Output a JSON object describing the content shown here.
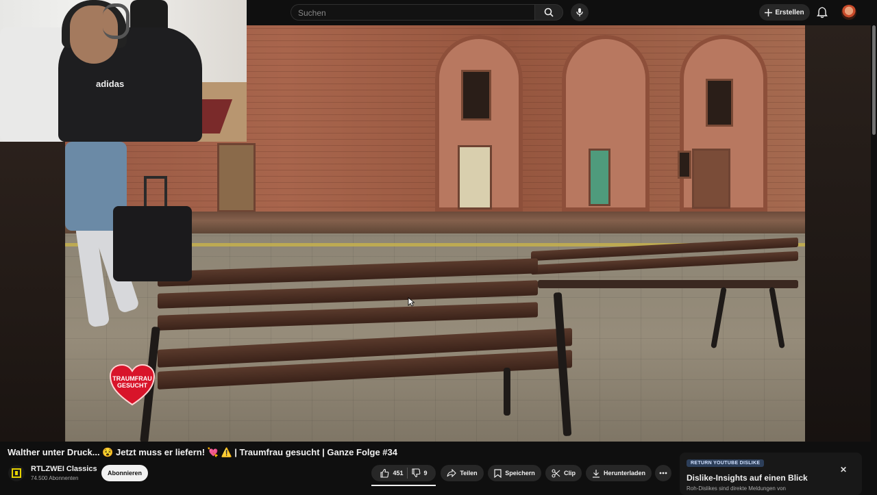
{
  "header": {
    "search_placeholder": "Suchen",
    "create_label": "Erstellen"
  },
  "video": {
    "overlay_logo_text": "TRAUMFRAU GESUCHT"
  },
  "webcam": {
    "shirt_text": "adidas"
  },
  "watch": {
    "title": "Walther unter Druck... 😵 Jetzt muss er liefern! 💘 ⚠️ | Traumfrau gesucht | Ganze Folge #34",
    "channel_name": "RTLZWEI Classics",
    "channel_subs": "74.500 Abonnenten",
    "subscribe_label": "Abonnieren",
    "likes": "451",
    "dislikes": "9",
    "share_label": "Teilen",
    "save_label": "Speichern",
    "clip_label": "Clip",
    "download_label": "Herunterladen"
  },
  "dislike_card": {
    "badge": "RETURN YOUTUBE DISLIKE",
    "title": "Dislike-Insights auf einen Blick",
    "subtitle": "Roh-Dislikes sind direkte Meldungen von"
  },
  "colors": {
    "background": "#0f0f0f",
    "pill": "#272727",
    "subscribe_button": "#f1f1f1"
  }
}
